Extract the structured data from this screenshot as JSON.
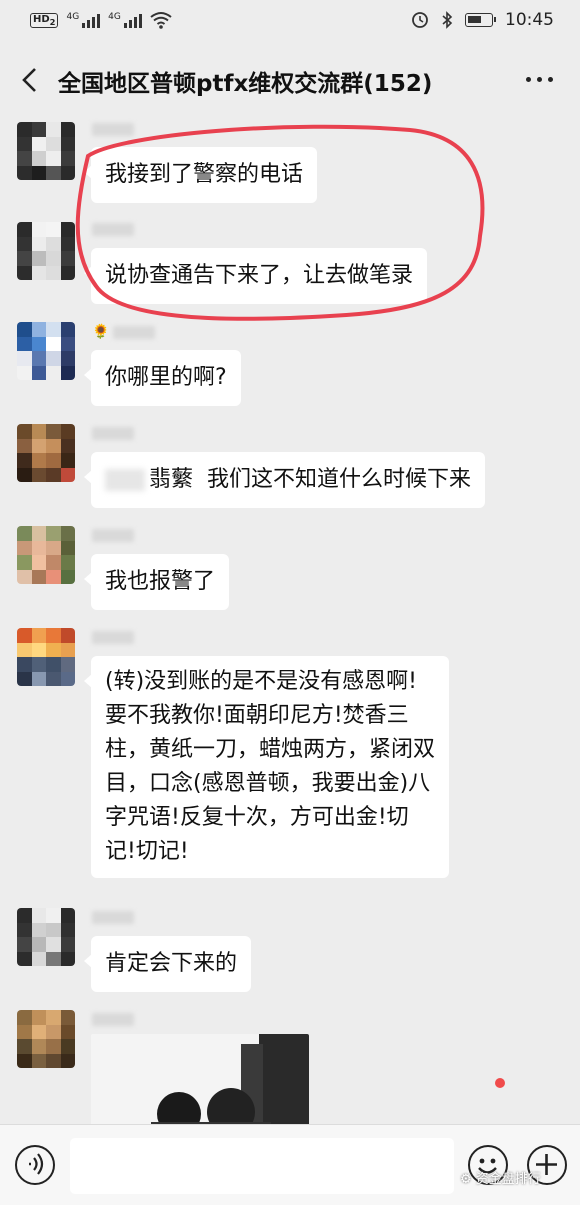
{
  "status_bar": {
    "network_badge": "HD",
    "network_badge_sub": "2",
    "signal1_label": "4G",
    "signal2_label": "4G",
    "time": "10:45",
    "icons": [
      "wifi-icon",
      "alarm-icon",
      "bluetooth-icon",
      "battery-icon"
    ]
  },
  "header": {
    "title": "全国地区普顿ptfx维权交流群(152)"
  },
  "messages": [
    {
      "text": "我接到了警察的电话",
      "sender_name": ""
    },
    {
      "text": "说协查通告下来了，让去做笔录",
      "sender_name": ""
    },
    {
      "text": "你哪里的啊?",
      "sender_name": ""
    },
    {
      "mention": "翡蘩",
      "text": "我们这不知道什么时候下来",
      "sender_name": ""
    },
    {
      "text": "我也报警了",
      "sender_name": ""
    },
    {
      "lines": [
        "(转)没到账的是不是没有感恩啊!",
        "要不我教你!面朝印尼方!焚香三",
        "柱，黄纸一刀，蜡烛两方，紧闭双",
        "目，口念(感恩普顿，我要出金)八",
        "字咒语!反复十次，方可出金!切",
        "记!切记!"
      ],
      "sender_name": ""
    },
    {
      "text": "肯定会下来的",
      "sender_name": ""
    }
  ],
  "input_bar": {
    "placeholder": "",
    "value": ""
  },
  "watermark": "资金盘排行",
  "colors": {
    "background": "#ededed",
    "bubble": "#ffffff",
    "annotation": "#e8414f"
  }
}
